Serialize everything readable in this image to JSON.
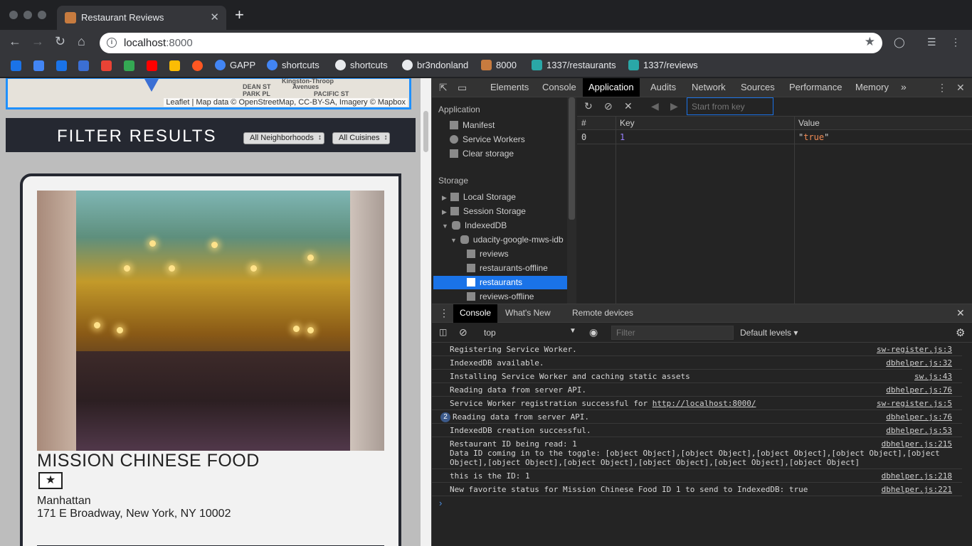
{
  "browser": {
    "tab_title": "Restaurant Reviews",
    "tab_close": "✕",
    "new_tab": "+",
    "url_host": "localhost",
    "url_port": ":8000",
    "bookmarks": [
      {
        "label": "GAPP",
        "color": "#4285f4"
      },
      {
        "label": "shortcuts",
        "color": "#4285f4"
      },
      {
        "label": "shortcuts",
        "color": "#e8eaed"
      },
      {
        "label": "br3ndonland",
        "color": "#e8eaed"
      },
      {
        "label": "8000",
        "color": "#c77b3f"
      },
      {
        "label": "1337/restaurants",
        "color": "#2aa7a7"
      },
      {
        "label": "1337/reviews",
        "color": "#2aa7a7"
      }
    ],
    "bookmark_icon_colors": [
      "#1a73e8",
      "#4285f4",
      "#1a73e8",
      "#3b6fd4",
      "#ea4335",
      "#34a853",
      "#ff0000",
      "#fbbc04",
      "#ff5722"
    ]
  },
  "page": {
    "map": {
      "attribution": "Leaflet | Map data © OpenStreetMap, CC-BY-SA, Imagery © Mapbox",
      "labels": [
        "Kingston-Throop",
        "DEAN ST",
        "PARK PL",
        "Avenues",
        "PACIFIC ST"
      ]
    },
    "filter": {
      "title": "FILTER RESULTS",
      "neighborhoods": "All Neighborhoods",
      "cuisines": "All Cuisines"
    },
    "restaurant": {
      "name": "MISSION CHINESE FOOD",
      "favorite_glyph": "★",
      "neighborhood": "Manhattan",
      "address": "171 E Broadway, New York, NY 10002"
    }
  },
  "devtools": {
    "tabs": [
      "Elements",
      "Console",
      "Application",
      "Audits",
      "Network",
      "Sources",
      "Performance",
      "Memory"
    ],
    "more": "»",
    "active_tab": "Application",
    "sidebar": {
      "application_header": "Application",
      "application_items": [
        "Manifest",
        "Service Workers",
        "Clear storage"
      ],
      "storage_header": "Storage",
      "storage_items": [
        "Local Storage",
        "Session Storage",
        "IndexedDB"
      ],
      "db_name": "udacity-google-mws-idb",
      "stores": [
        "reviews",
        "restaurants-offline",
        "restaurants",
        "reviews-offline"
      ],
      "selected_store": "restaurants"
    },
    "idb": {
      "start_placeholder": "Start from key",
      "columns": [
        "#",
        "Key",
        "Value"
      ],
      "rows": [
        {
          "index": "0",
          "key": "1",
          "value_q1": "\"",
          "value": "true",
          "value_q2": "\""
        }
      ]
    },
    "drawer": {
      "tabs": [
        "Console",
        "What's New",
        "Remote devices"
      ],
      "active": "Console",
      "context": "top",
      "filter_placeholder": "Filter",
      "levels": "Default levels ▾"
    },
    "console": [
      {
        "text": "Registering Service Worker.",
        "source": "sw-register.js:3"
      },
      {
        "text": "IndexedDB available.",
        "source": "dbhelper.js:32"
      },
      {
        "text": "Installing Service Worker and caching static assets",
        "source": "sw.js:43"
      },
      {
        "text": "Reading data from server API.",
        "source": "dbhelper.js:76"
      },
      {
        "text": "Service Worker registration successful for ",
        "link": "http://localhost:8000/",
        "source": "sw-register.js:5"
      },
      {
        "count": "2",
        "text": "Reading data from server API.",
        "source": "dbhelper.js:76"
      },
      {
        "text": "IndexedDB creation successful.",
        "source": "dbhelper.js:53"
      },
      {
        "text": "Restaurant ID being read: 1\nData ID coming in to the toggle: [object Object],[object Object],[object Object],[object Object],[object\nObject],[object Object],[object Object],[object Object],[object Object],[object Object]",
        "source": "dbhelper.js:215"
      },
      {
        "text": "this is the ID: 1",
        "source": "dbhelper.js:218"
      },
      {
        "text": "New favorite status for Mission Chinese Food ID 1 to send to IndexedDB: true",
        "source": "dbhelper.js:221"
      }
    ],
    "prompt": "›"
  }
}
